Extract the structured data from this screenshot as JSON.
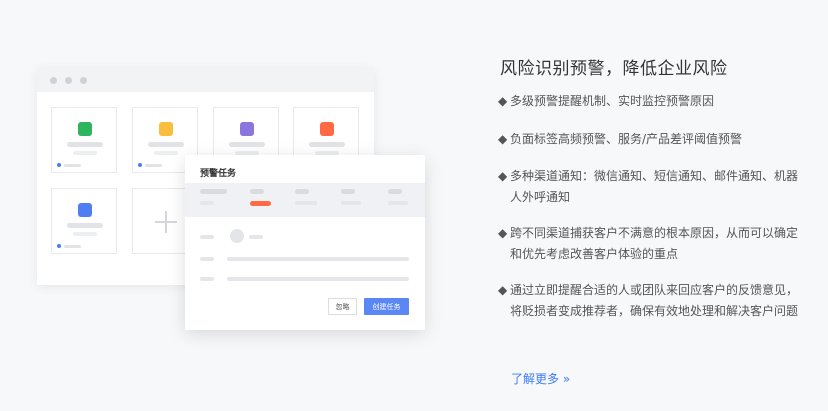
{
  "heading": "风险识别预警，降低企业风险",
  "bullet": "◆",
  "features": [
    "多级预警提醒机制、实时监控预警原因",
    "负面标签高频预警、服务/产品差评阈值预警",
    "多种渠道通知：微信通知、短信通知、邮件通知、机器人外呼通知",
    "跨不同渠道捕获客户不满意的根本原因，从而可以确定和优先考虑改善客户体验的重点",
    "通过立即提醒合适的人或团队来回应客户的反馈意见，将贬损者变成推荐者，确保有效地处理和解决客户问题"
  ],
  "learn_more": "了解更多 »",
  "dialog": {
    "title": "预警任务",
    "ignore_label": "忽略",
    "create_label": "创建任务"
  },
  "colors": {
    "card_green": "#2fb35c",
    "card_yellow": "#f8be3c",
    "card_purple": "#8b76e0",
    "card_orange": "#ff6a45",
    "card_blue": "#4f7ef3",
    "accent_blue": "#5b87f5",
    "link_blue": "#3d7bf4"
  }
}
